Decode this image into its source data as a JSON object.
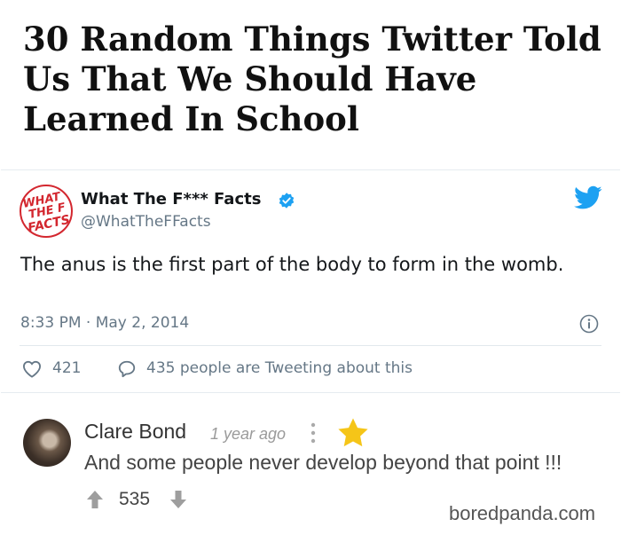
{
  "article": {
    "title": "30 Random Things Twitter Told Us That We Should Have Learned In School"
  },
  "tweet": {
    "author_name": "What The F*** Facts",
    "handle": "@WhatTheFFacts",
    "text": "The anus is the first part of the body to form in the womb.",
    "timestamp": "8:33 PM · May 2, 2014",
    "likes": "421",
    "tweeting": "435 people are Tweeting about this",
    "logo_lines": [
      "WHAT",
      "THE F",
      "FACTS"
    ],
    "colors": {
      "accent": "#1da1f2",
      "logo_red": "#d3272f",
      "verified": "#1da1f2"
    }
  },
  "comment": {
    "author": "Clare Bond",
    "time": "1 year ago",
    "text": "And some people never develop beyond that point !!!",
    "votes": "535",
    "colors": {
      "star": "#f5c518",
      "vote": "#9e9e9e"
    }
  },
  "footer": {
    "watermark": "boredpanda.com"
  },
  "icons": [
    "twitter-bird-icon",
    "verified-badge-icon",
    "info-icon",
    "heart-icon",
    "reply-bubble-icon",
    "kebab-menu-icon",
    "star-icon",
    "upvote-arrow-icon",
    "downvote-arrow-icon"
  ]
}
